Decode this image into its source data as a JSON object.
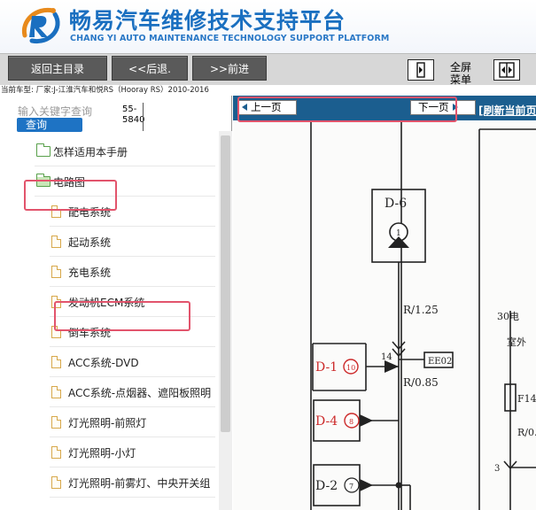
{
  "header": {
    "title": "畅易汽车维修技术支持平台",
    "subtitle": "CHANG YI AUTO MAINTENANCE TECHNOLOGY SUPPORT PLATFORM"
  },
  "toolbar": {
    "home_label": "返回主目录",
    "back_label": "<<后退.",
    "forward_label": ">>前进",
    "fullscreen_line1": "全屏",
    "fullscreen_line2": "菜单"
  },
  "car_line": "当前车型:  厂家:J-江淮汽车和悦RS（Hooray RS）2010-2016",
  "search": {
    "placeholder": "输入关键字查询",
    "button_label": "查询",
    "count_line1": "55-",
    "count_line2": "5840"
  },
  "tree": {
    "items": [
      {
        "label": "怎样适用本手册",
        "type": "folder"
      },
      {
        "label": "电路图",
        "type": "folder-open"
      },
      {
        "label": "配电系统",
        "type": "doc"
      },
      {
        "label": "起动系统",
        "type": "doc"
      },
      {
        "label": "充电系统",
        "type": "doc"
      },
      {
        "label": "发动机ECM系统",
        "type": "doc"
      },
      {
        "label": "倒车系统",
        "type": "doc"
      },
      {
        "label": "ACC系统-DVD",
        "type": "doc"
      },
      {
        "label": "ACC系统-点烟器、遮阳板照明",
        "type": "doc"
      },
      {
        "label": "灯光照明-前照灯",
        "type": "doc"
      },
      {
        "label": "灯光照明-小灯",
        "type": "doc"
      },
      {
        "label": "灯光照明-前雾灯、中央开关组",
        "type": "doc"
      }
    ]
  },
  "content": {
    "prev_label": "上一页",
    "next_label": "下一页",
    "refresh_label": "[刷新当前页]"
  },
  "diagram": {
    "d6": "D-6",
    "d6_pin": "1",
    "wire1": "R/1.25",
    "pin14": "14",
    "ee02": "EE02",
    "wire2": "R/0.85",
    "d1": "D-1",
    "d1_pin": "10",
    "d4": "D-4",
    "d4_pin": "8",
    "d2": "D-2",
    "d2_pin": "7",
    "label_30": "30电",
    "label_room": "室外",
    "fuse": "F14",
    "label_r0": "R/0.",
    "pin3": "3"
  },
  "colors": {
    "brand": "#1a6fc0",
    "toolbar_button": "#5a5a5a",
    "content_bar": "#1b5e8f",
    "highlight": "#e2546c",
    "diagram_red": "#cc2a2a"
  }
}
